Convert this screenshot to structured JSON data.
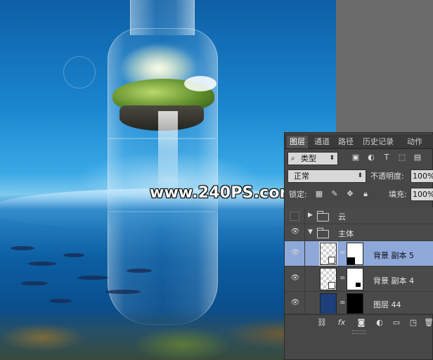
{
  "watermark": "www.240PS.com",
  "panel": {
    "tabs": [
      "图层",
      "通道",
      "路径",
      "历史记录",
      "动作"
    ],
    "filter_kind": "类型",
    "blend_mode": "正常",
    "opacity_label": "不透明度:",
    "opacity_value": "100%",
    "lock_label": "锁定:",
    "fill_label": "填充:",
    "fill_value": "100%",
    "layers": [
      {
        "name": "云",
        "type": "group",
        "expanded": false,
        "visible": false
      },
      {
        "name": "主体",
        "type": "group",
        "expanded": true,
        "visible": true
      },
      {
        "name": "背景 副本 5",
        "type": "smart-object-with-mask",
        "visible": true,
        "selected": true
      },
      {
        "name": "背景 副本 4",
        "type": "smart-object-with-mask",
        "visible": true,
        "selected": false
      },
      {
        "name": "图层 44",
        "type": "layer-with-mask",
        "visible": true,
        "selected": false
      }
    ],
    "footer_icons": [
      "link-icon",
      "fx-icon",
      "add-mask-icon",
      "adjustment-icon",
      "new-group-icon",
      "new-layer-icon",
      "delete-icon"
    ]
  },
  "colors": {
    "panel_bg": "#474747",
    "selected_row": "#8ea8d9",
    "workspace_gray": "#6b6b6b"
  }
}
